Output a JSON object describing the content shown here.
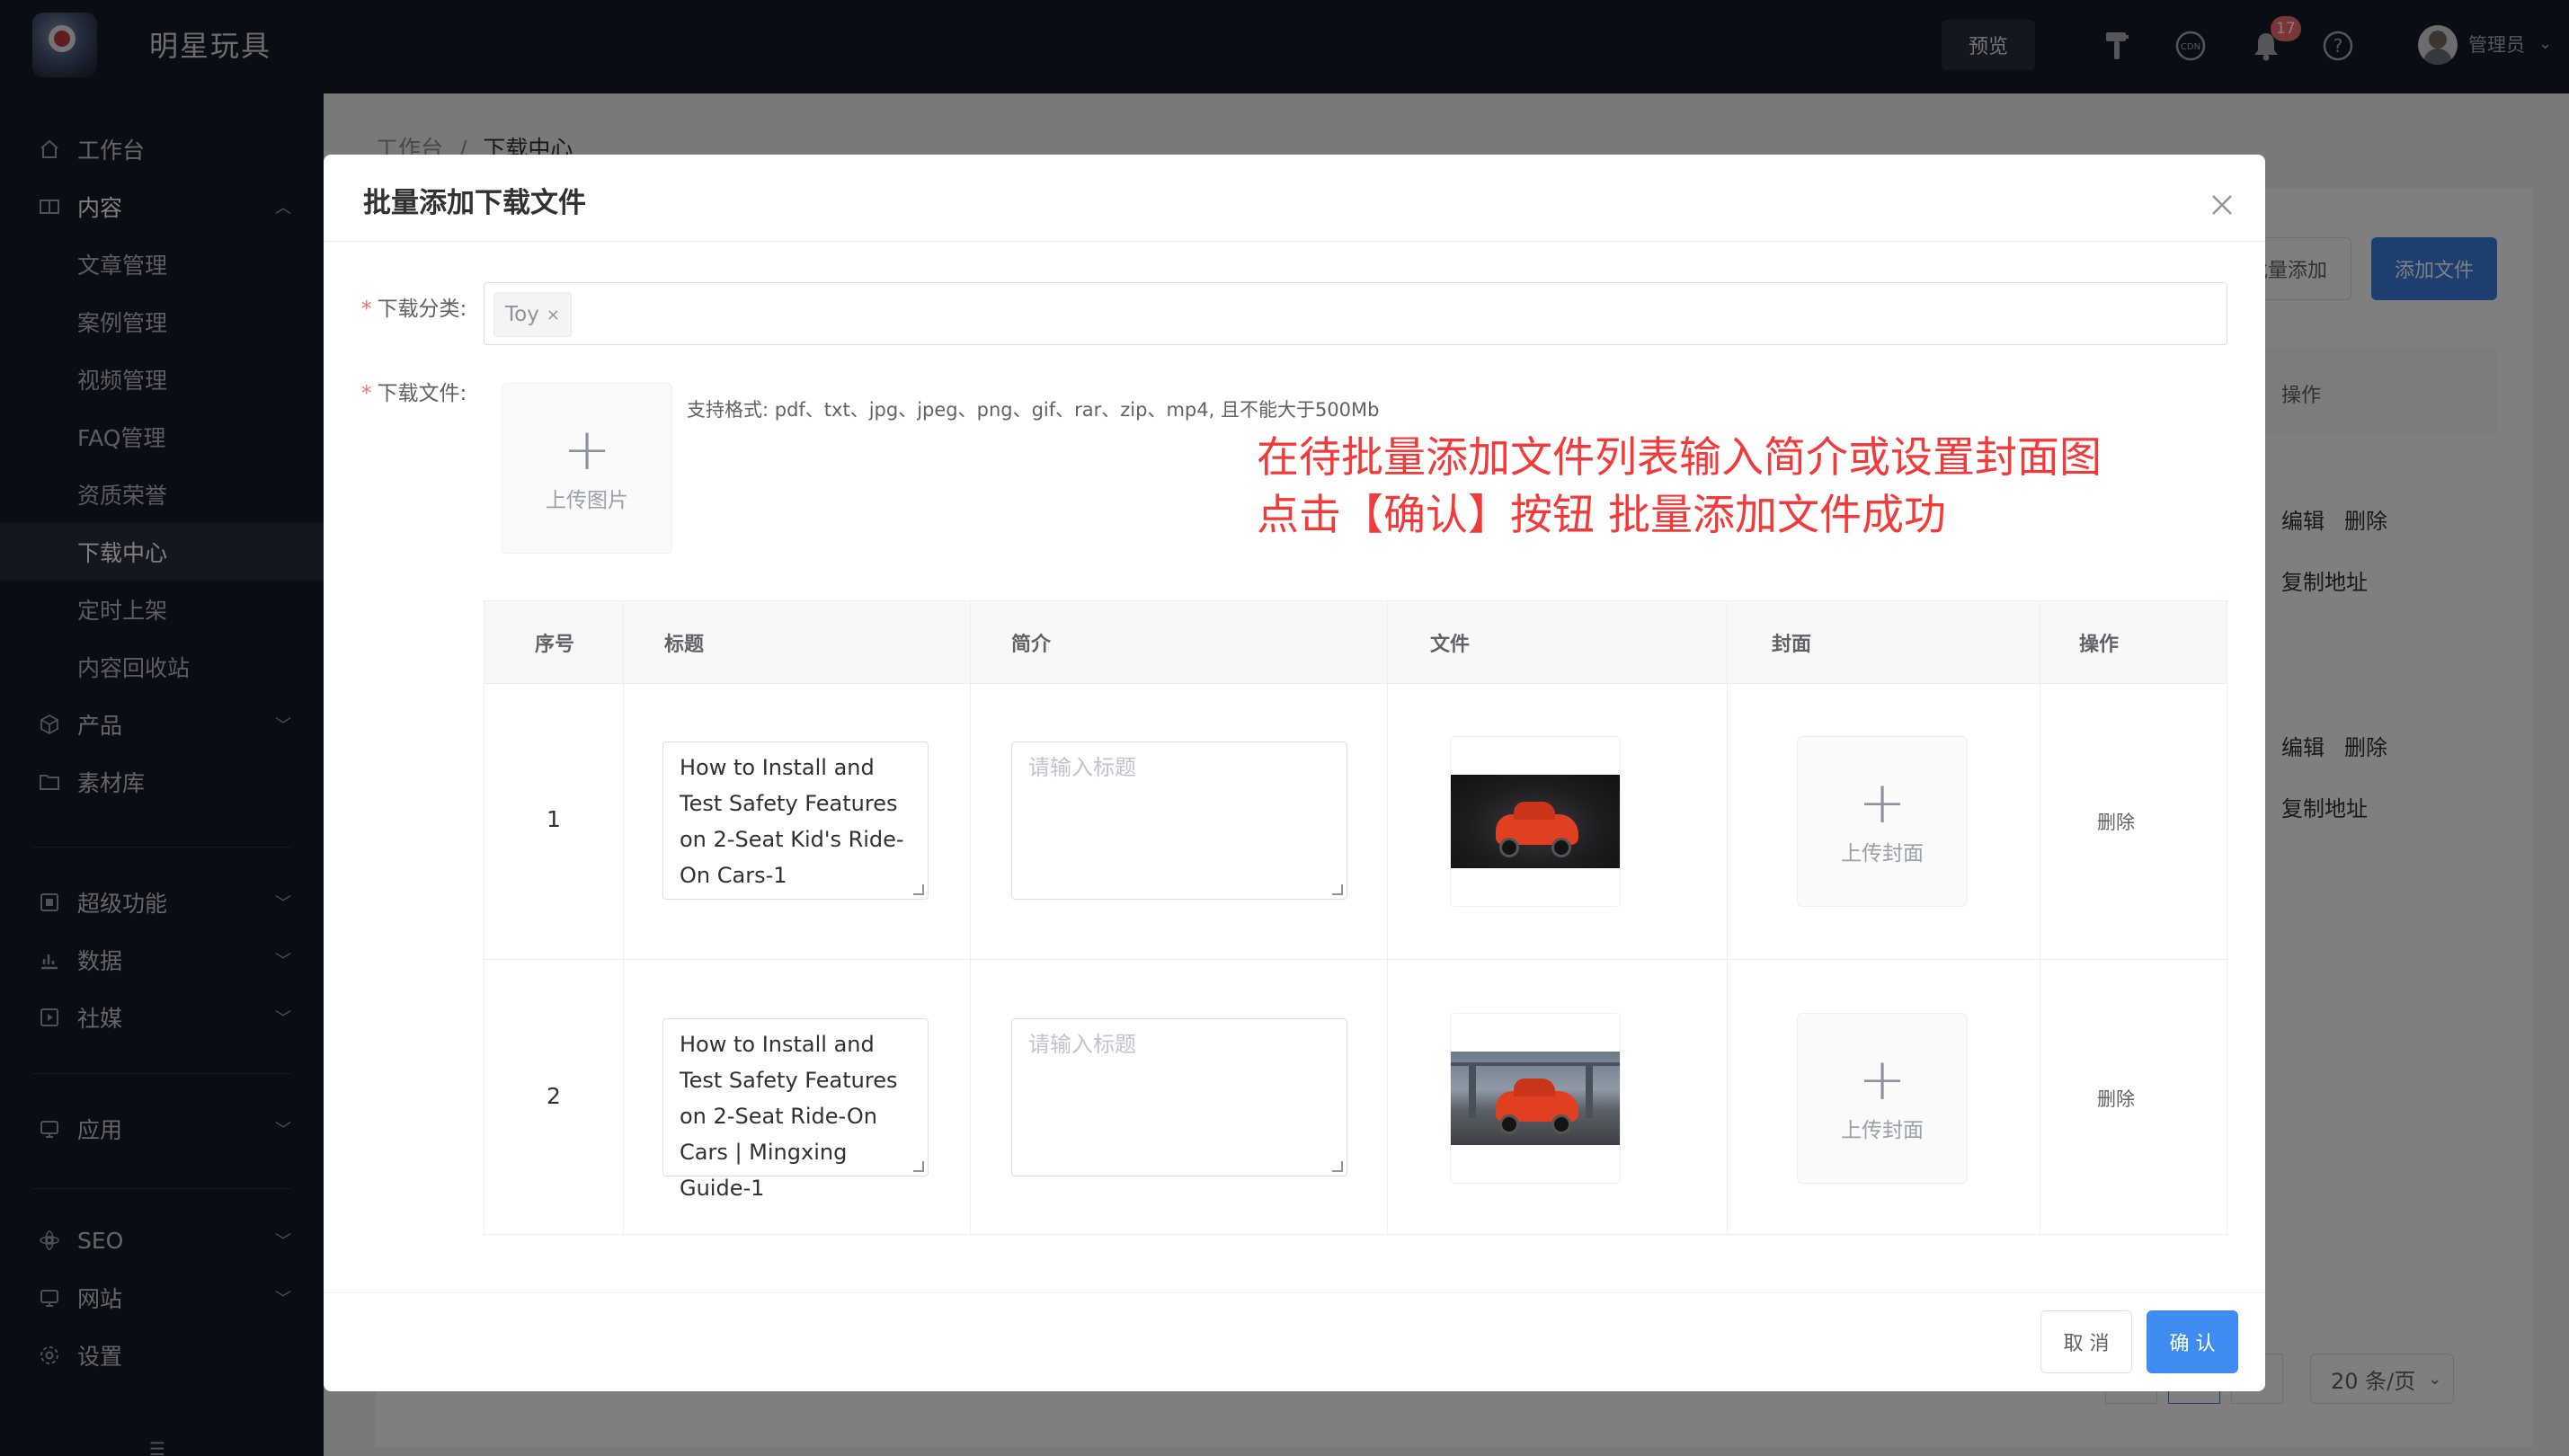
{
  "app": {
    "title": "明星玩具"
  },
  "topbar": {
    "preview_label": "预览",
    "notification_count": "17",
    "user_name": "管理员",
    "icons": [
      "brush-icon",
      "cdn-icon",
      "bell-icon",
      "help-icon"
    ]
  },
  "sidebar": {
    "items": [
      {
        "label": "工作台",
        "icon": "home-icon"
      },
      {
        "label": "内容",
        "icon": "book-icon",
        "expanded": true
      },
      {
        "label": "文章管理"
      },
      {
        "label": "案例管理"
      },
      {
        "label": "视频管理"
      },
      {
        "label": "FAQ管理"
      },
      {
        "label": "资质荣誉"
      },
      {
        "label": "下载中心",
        "active": true
      },
      {
        "label": "定时上架"
      },
      {
        "label": "内容回收站"
      },
      {
        "label": "产品",
        "icon": "box-icon"
      },
      {
        "label": "素材库",
        "icon": "folder-icon"
      },
      {
        "label": "超级功能",
        "icon": "layers-icon"
      },
      {
        "label": "数据",
        "icon": "chart-icon"
      },
      {
        "label": "社媒",
        "icon": "media-icon"
      },
      {
        "label": "应用",
        "icon": "app-icon"
      },
      {
        "label": "SEO",
        "icon": "seo-icon"
      },
      {
        "label": "网站",
        "icon": "monitor-icon"
      },
      {
        "label": "设置",
        "icon": "gear-icon"
      }
    ]
  },
  "page": {
    "breadcrumb_root": "工作台",
    "breadcrumb_sep": "/",
    "breadcrumb_current": "下载中心",
    "batch_add_label": "批量添加",
    "add_file_label": "添加文件",
    "actions_header": "操作",
    "edit_label": "编辑",
    "delete_label": "删除",
    "copy_url_label": "复制地址",
    "page_size_label": "20 条/页"
  },
  "dialog": {
    "title": "批量添加下载文件",
    "category_label": "下载分类",
    "category_tag": "Toy",
    "file_label": "下载文件",
    "label_suffix": ":",
    "upload_image_label": "上传图片",
    "format_hint": "支持格式: pdf、txt、jpg、jpeg、png、gif、rar、zip、mp4, 且不能大于500Mb",
    "annotation_line1": "在待批量添加文件列表输入简介或设置封面图",
    "annotation_line2": "点击【确认】按钮 批量添加文件成功",
    "table": {
      "headers": [
        "序号",
        "标题",
        "简介",
        "文件",
        "封面",
        "操作"
      ],
      "rows": [
        {
          "index": "1",
          "title": "How to Install and Test Safety Features on 2-Seat Kid's Ride-On Cars-1",
          "intro_placeholder": "请输入标题",
          "cover_label": "上传封面",
          "delete_label": "删除"
        },
        {
          "index": "2",
          "title": "How to Install and Test Safety Features on 2-Seat Ride-On Cars | Mingxing Guide-1",
          "intro_placeholder": "请输入标题",
          "cover_label": "上传封面",
          "delete_label": "删除"
        }
      ]
    },
    "cancel_label": "取 消",
    "confirm_label": "确 认"
  }
}
